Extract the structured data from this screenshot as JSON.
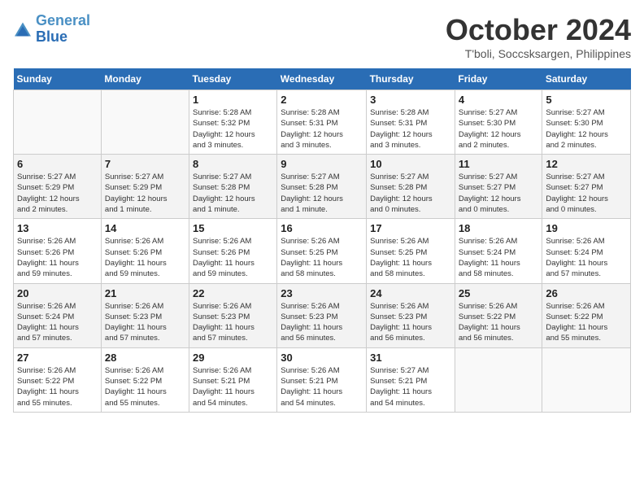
{
  "header": {
    "logo_line1": "General",
    "logo_line2": "Blue",
    "month": "October 2024",
    "location": "T'boli, Soccsksargen, Philippines"
  },
  "weekdays": [
    "Sunday",
    "Monday",
    "Tuesday",
    "Wednesday",
    "Thursday",
    "Friday",
    "Saturday"
  ],
  "weeks": [
    [
      {
        "day": "",
        "info": ""
      },
      {
        "day": "",
        "info": ""
      },
      {
        "day": "1",
        "info": "Sunrise: 5:28 AM\nSunset: 5:32 PM\nDaylight: 12 hours\nand 3 minutes."
      },
      {
        "day": "2",
        "info": "Sunrise: 5:28 AM\nSunset: 5:31 PM\nDaylight: 12 hours\nand 3 minutes."
      },
      {
        "day": "3",
        "info": "Sunrise: 5:28 AM\nSunset: 5:31 PM\nDaylight: 12 hours\nand 3 minutes."
      },
      {
        "day": "4",
        "info": "Sunrise: 5:27 AM\nSunset: 5:30 PM\nDaylight: 12 hours\nand 2 minutes."
      },
      {
        "day": "5",
        "info": "Sunrise: 5:27 AM\nSunset: 5:30 PM\nDaylight: 12 hours\nand 2 minutes."
      }
    ],
    [
      {
        "day": "6",
        "info": "Sunrise: 5:27 AM\nSunset: 5:29 PM\nDaylight: 12 hours\nand 2 minutes."
      },
      {
        "day": "7",
        "info": "Sunrise: 5:27 AM\nSunset: 5:29 PM\nDaylight: 12 hours\nand 1 minute."
      },
      {
        "day": "8",
        "info": "Sunrise: 5:27 AM\nSunset: 5:28 PM\nDaylight: 12 hours\nand 1 minute."
      },
      {
        "day": "9",
        "info": "Sunrise: 5:27 AM\nSunset: 5:28 PM\nDaylight: 12 hours\nand 1 minute."
      },
      {
        "day": "10",
        "info": "Sunrise: 5:27 AM\nSunset: 5:28 PM\nDaylight: 12 hours\nand 0 minutes."
      },
      {
        "day": "11",
        "info": "Sunrise: 5:27 AM\nSunset: 5:27 PM\nDaylight: 12 hours\nand 0 minutes."
      },
      {
        "day": "12",
        "info": "Sunrise: 5:27 AM\nSunset: 5:27 PM\nDaylight: 12 hours\nand 0 minutes."
      }
    ],
    [
      {
        "day": "13",
        "info": "Sunrise: 5:26 AM\nSunset: 5:26 PM\nDaylight: 11 hours\nand 59 minutes."
      },
      {
        "day": "14",
        "info": "Sunrise: 5:26 AM\nSunset: 5:26 PM\nDaylight: 11 hours\nand 59 minutes."
      },
      {
        "day": "15",
        "info": "Sunrise: 5:26 AM\nSunset: 5:26 PM\nDaylight: 11 hours\nand 59 minutes."
      },
      {
        "day": "16",
        "info": "Sunrise: 5:26 AM\nSunset: 5:25 PM\nDaylight: 11 hours\nand 58 minutes."
      },
      {
        "day": "17",
        "info": "Sunrise: 5:26 AM\nSunset: 5:25 PM\nDaylight: 11 hours\nand 58 minutes."
      },
      {
        "day": "18",
        "info": "Sunrise: 5:26 AM\nSunset: 5:24 PM\nDaylight: 11 hours\nand 58 minutes."
      },
      {
        "day": "19",
        "info": "Sunrise: 5:26 AM\nSunset: 5:24 PM\nDaylight: 11 hours\nand 57 minutes."
      }
    ],
    [
      {
        "day": "20",
        "info": "Sunrise: 5:26 AM\nSunset: 5:24 PM\nDaylight: 11 hours\nand 57 minutes."
      },
      {
        "day": "21",
        "info": "Sunrise: 5:26 AM\nSunset: 5:23 PM\nDaylight: 11 hours\nand 57 minutes."
      },
      {
        "day": "22",
        "info": "Sunrise: 5:26 AM\nSunset: 5:23 PM\nDaylight: 11 hours\nand 57 minutes."
      },
      {
        "day": "23",
        "info": "Sunrise: 5:26 AM\nSunset: 5:23 PM\nDaylight: 11 hours\nand 56 minutes."
      },
      {
        "day": "24",
        "info": "Sunrise: 5:26 AM\nSunset: 5:23 PM\nDaylight: 11 hours\nand 56 minutes."
      },
      {
        "day": "25",
        "info": "Sunrise: 5:26 AM\nSunset: 5:22 PM\nDaylight: 11 hours\nand 56 minutes."
      },
      {
        "day": "26",
        "info": "Sunrise: 5:26 AM\nSunset: 5:22 PM\nDaylight: 11 hours\nand 55 minutes."
      }
    ],
    [
      {
        "day": "27",
        "info": "Sunrise: 5:26 AM\nSunset: 5:22 PM\nDaylight: 11 hours\nand 55 minutes."
      },
      {
        "day": "28",
        "info": "Sunrise: 5:26 AM\nSunset: 5:22 PM\nDaylight: 11 hours\nand 55 minutes."
      },
      {
        "day": "29",
        "info": "Sunrise: 5:26 AM\nSunset: 5:21 PM\nDaylight: 11 hours\nand 54 minutes."
      },
      {
        "day": "30",
        "info": "Sunrise: 5:26 AM\nSunset: 5:21 PM\nDaylight: 11 hours\nand 54 minutes."
      },
      {
        "day": "31",
        "info": "Sunrise: 5:27 AM\nSunset: 5:21 PM\nDaylight: 11 hours\nand 54 minutes."
      },
      {
        "day": "",
        "info": ""
      },
      {
        "day": "",
        "info": ""
      }
    ]
  ]
}
